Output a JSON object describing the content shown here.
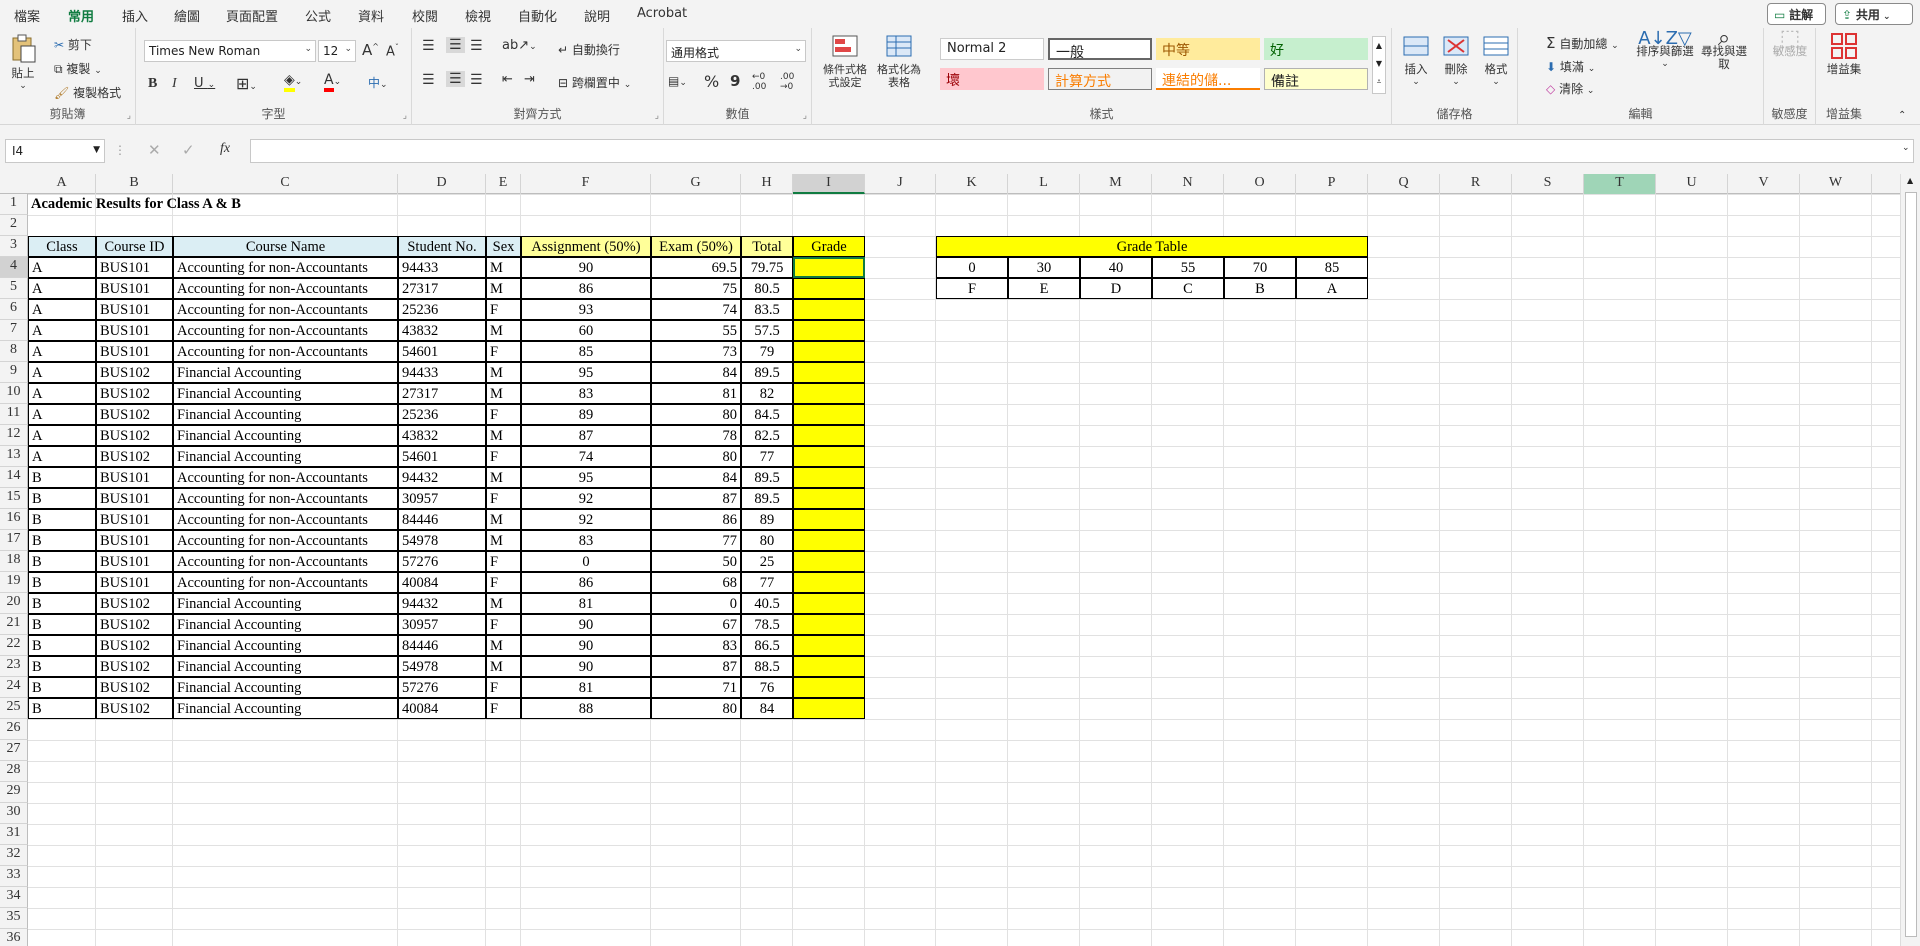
{
  "menu": {
    "tabs": [
      "檔案",
      "常用",
      "插入",
      "繪圖",
      "頁面配置",
      "公式",
      "資料",
      "校閱",
      "檢視",
      "自動化",
      "說明",
      "Acrobat"
    ],
    "active_tab": "常用",
    "comment_label": "註解",
    "share_label": "共用"
  },
  "ribbon": {
    "clipboard": {
      "label": "剪貼簿",
      "paste": "貼上",
      "cut": "剪下",
      "copy": "複製",
      "format_painter": "複製格式"
    },
    "font": {
      "label": "字型",
      "font_name": "Times New Roman",
      "font_size": "12",
      "bold": "B",
      "italic": "I",
      "underline": "U",
      "grow": "A",
      "shrink": "A",
      "phonetic": "中"
    },
    "alignment": {
      "label": "對齊方式",
      "wrap": "自動換行",
      "merge": "跨欄置中"
    },
    "number": {
      "label": "數值",
      "format": "通用格式",
      "percent": "%",
      "comma": "9",
      "inc_decimal": "←0 .00",
      "dec_decimal": ".00 →0"
    },
    "styles": {
      "label": "樣式",
      "conditional": "條件式格式設定",
      "as_table": "格式化為表格",
      "items": [
        {
          "name": "Normal 2",
          "bg": "#ffffff",
          "fg": "#000000"
        },
        {
          "name": "一般",
          "bg": "#ffffff",
          "fg": "#000000"
        },
        {
          "name": "中等",
          "bg": "#ffeb9c",
          "fg": "#9c5700"
        },
        {
          "name": "好",
          "bg": "#c6efce",
          "fg": "#006100"
        },
        {
          "name": "壞",
          "bg": "#ffc7ce",
          "fg": "#9c0006"
        },
        {
          "name": "計算方式",
          "bg": "#f2f2f2",
          "fg": "#fa7d00"
        },
        {
          "name": "連結的儲...",
          "bg": "#ffffff",
          "fg": "#fa7d00"
        },
        {
          "name": "備註",
          "bg": "#ffffcc",
          "fg": "#000000"
        }
      ]
    },
    "cells": {
      "label": "儲存格",
      "insert": "插入",
      "delete": "刪除",
      "format": "格式"
    },
    "editing": {
      "label": "編輯",
      "autosum": "自動加總",
      "fill": "填滿",
      "clear": "清除",
      "sort": "排序與篩選",
      "find": "尋找與選取"
    },
    "sensitivity": {
      "label": "敏感度",
      "btn": "敏感度"
    },
    "addins": {
      "label": "增益集",
      "btn": "增益集"
    }
  },
  "formula_bar": {
    "name_box": "I4",
    "fx": "fx",
    "formula": ""
  },
  "columns": [
    "A",
    "B",
    "C",
    "D",
    "E",
    "F",
    "G",
    "H",
    "I",
    "J",
    "K",
    "L",
    "M",
    "N",
    "O",
    "P",
    "Q",
    "R",
    "S",
    "T",
    "U",
    "V",
    "W"
  ],
  "rows": [
    "1",
    "2",
    "3",
    "4",
    "5",
    "6",
    "7",
    "8",
    "9",
    "10",
    "11",
    "12",
    "13",
    "14",
    "15",
    "16",
    "17",
    "18",
    "19",
    "20",
    "21",
    "22",
    "23",
    "24",
    "25",
    "26",
    "27",
    "28",
    "29",
    "30",
    "31",
    "32",
    "33",
    "34",
    "35",
    "36"
  ],
  "sheet": {
    "title": "Academic Results for Class A & B",
    "headers": [
      "Class",
      "Course ID",
      "Course Name",
      "Student No.",
      "Sex",
      "Assignment (50%)",
      "Exam (50%)",
      "Total",
      "Grade"
    ],
    "data": [
      [
        "A",
        "BUS101",
        "Accounting for non-Accountants",
        "94433",
        "M",
        "90",
        "69.5",
        "79.75"
      ],
      [
        "A",
        "BUS101",
        "Accounting for non-Accountants",
        "27317",
        "M",
        "86",
        "75",
        "80.5"
      ],
      [
        "A",
        "BUS101",
        "Accounting for non-Accountants",
        "25236",
        "F",
        "93",
        "74",
        "83.5"
      ],
      [
        "A",
        "BUS101",
        "Accounting for non-Accountants",
        "43832",
        "M",
        "60",
        "55",
        "57.5"
      ],
      [
        "A",
        "BUS101",
        "Accounting for non-Accountants",
        "54601",
        "F",
        "85",
        "73",
        "79"
      ],
      [
        "A",
        "BUS102",
        "Financial Accounting",
        "94433",
        "M",
        "95",
        "84",
        "89.5"
      ],
      [
        "A",
        "BUS102",
        "Financial Accounting",
        "27317",
        "M",
        "83",
        "81",
        "82"
      ],
      [
        "A",
        "BUS102",
        "Financial Accounting",
        "25236",
        "F",
        "89",
        "80",
        "84.5"
      ],
      [
        "A",
        "BUS102",
        "Financial Accounting",
        "43832",
        "M",
        "87",
        "78",
        "82.5"
      ],
      [
        "A",
        "BUS102",
        "Financial Accounting",
        "54601",
        "F",
        "74",
        "80",
        "77"
      ],
      [
        "B",
        "BUS101",
        "Accounting for non-Accountants",
        "94432",
        "M",
        "95",
        "84",
        "89.5"
      ],
      [
        "B",
        "BUS101",
        "Accounting for non-Accountants",
        "30957",
        "F",
        "92",
        "87",
        "89.5"
      ],
      [
        "B",
        "BUS101",
        "Accounting for non-Accountants",
        "84446",
        "M",
        "92",
        "86",
        "89"
      ],
      [
        "B",
        "BUS101",
        "Accounting for non-Accountants",
        "54978",
        "M",
        "83",
        "77",
        "80"
      ],
      [
        "B",
        "BUS101",
        "Accounting for non-Accountants",
        "57276",
        "F",
        "0",
        "50",
        "25"
      ],
      [
        "B",
        "BUS101",
        "Accounting for non-Accountants",
        "40084",
        "F",
        "86",
        "68",
        "77"
      ],
      [
        "B",
        "BUS102",
        "Financial Accounting",
        "94432",
        "M",
        "81",
        "0",
        "40.5"
      ],
      [
        "B",
        "BUS102",
        "Financial Accounting",
        "30957",
        "F",
        "90",
        "67",
        "78.5"
      ],
      [
        "B",
        "BUS102",
        "Financial Accounting",
        "84446",
        "M",
        "90",
        "83",
        "86.5"
      ],
      [
        "B",
        "BUS102",
        "Financial Accounting",
        "54978",
        "M",
        "90",
        "87",
        "88.5"
      ],
      [
        "B",
        "BUS102",
        "Financial Accounting",
        "57276",
        "F",
        "81",
        "71",
        "76"
      ],
      [
        "B",
        "BUS102",
        "Financial Accounting",
        "40084",
        "F",
        "88",
        "80",
        "84"
      ]
    ],
    "grade_table": {
      "title": "Grade Table",
      "scores": [
        "0",
        "30",
        "40",
        "55",
        "70",
        "85"
      ],
      "grades": [
        "F",
        "E",
        "D",
        "C",
        "B",
        "A"
      ]
    }
  }
}
